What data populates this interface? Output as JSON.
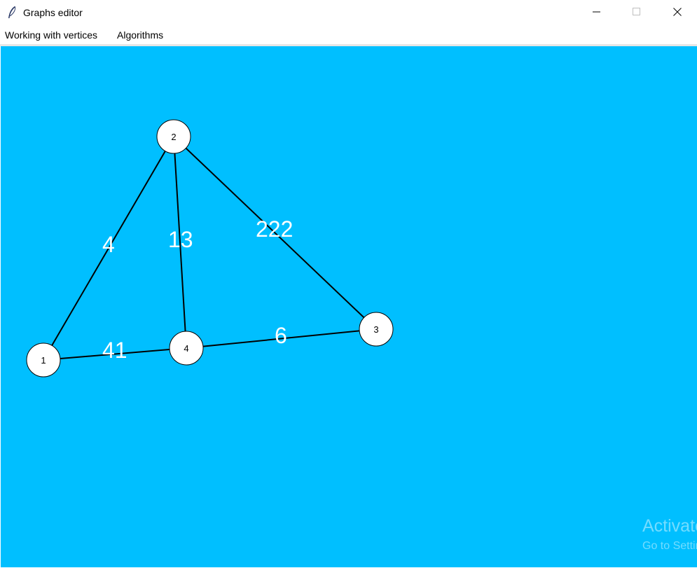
{
  "window": {
    "title": "Graphs editor",
    "app_icon": "feather-icon"
  },
  "menu": {
    "items": [
      {
        "label": "Working with vertices"
      },
      {
        "label": "Algorithms"
      }
    ]
  },
  "graph": {
    "background_color": "#00bfff",
    "vertices": [
      {
        "id": "1",
        "label": "1"
      },
      {
        "id": "2",
        "label": "2"
      },
      {
        "id": "3",
        "label": "3"
      },
      {
        "id": "4",
        "label": "4"
      }
    ],
    "edges": [
      {
        "from": "2",
        "to": "1",
        "weight": "4"
      },
      {
        "from": "2",
        "to": "4",
        "weight": "13"
      },
      {
        "from": "2",
        "to": "3",
        "weight": "222"
      },
      {
        "from": "1",
        "to": "4",
        "weight": "41"
      },
      {
        "from": "4",
        "to": "3",
        "weight": "6"
      }
    ]
  },
  "watermark": {
    "line1": "Activate",
    "line2": "Go to Settings"
  }
}
